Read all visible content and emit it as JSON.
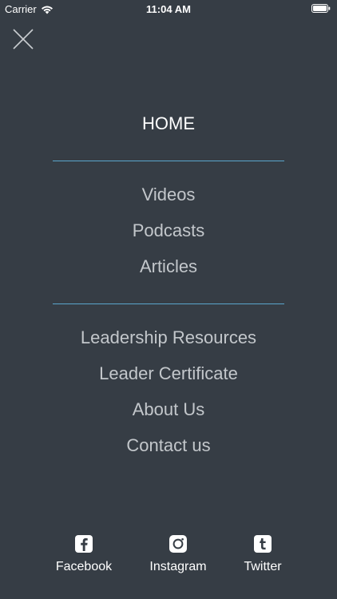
{
  "status_bar": {
    "carrier": "Carrier",
    "time": "11:04 AM",
    "wifi_icon": "wifi-icon",
    "battery_icon": "battery-icon"
  },
  "close_icon": "close-icon",
  "menu": {
    "home": "HOME",
    "section1": [
      "Videos",
      "Podcasts",
      "Articles"
    ],
    "section2": [
      "Leadership Resources",
      "Leader Certificate",
      "About Us",
      "Contact us"
    ]
  },
  "social": [
    {
      "label": "Facebook",
      "icon": "facebook-icon"
    },
    {
      "label": "Instagram",
      "icon": "instagram-icon"
    },
    {
      "label": "Twitter",
      "icon": "tumblr-icon"
    }
  ],
  "colors": {
    "background": "#363d45",
    "divider": "#5aa6cc",
    "menu_text": "#c3c7cb",
    "home_text": "#ffffff"
  }
}
